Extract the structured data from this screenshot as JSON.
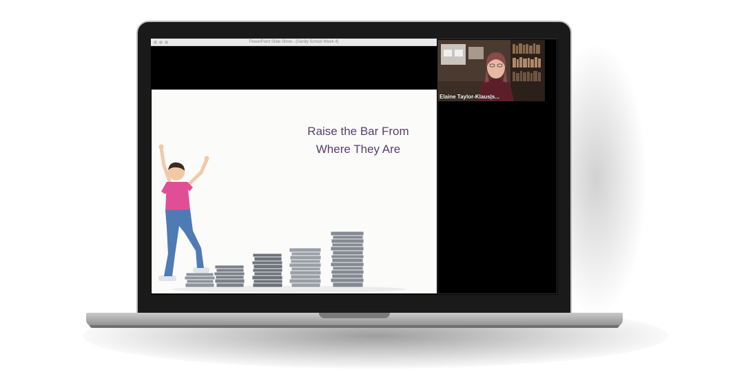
{
  "window": {
    "title": "PowerPoint Slide Show - [Sanity School Week 4]"
  },
  "slide": {
    "title_line1": "Raise the Bar From",
    "title_line2": "Where They Are"
  },
  "video": {
    "participant_name": "Elaine Taylor-Klaus|s..."
  },
  "colors": {
    "slide_title": "#5a3d6b",
    "laptop_bezel": "#1a1a1a",
    "screen_bg": "#000000"
  }
}
